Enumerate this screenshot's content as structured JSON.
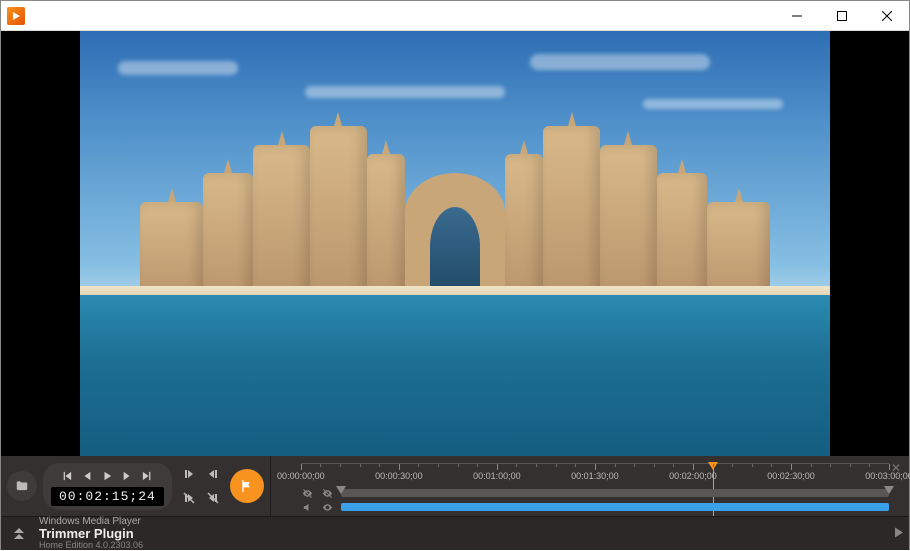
{
  "titlebar": {
    "app_name": ""
  },
  "transport": {
    "timecode": "00:02:15;24"
  },
  "timeline": {
    "ticks": [
      "00:00:00;00",
      "00:00:30;00",
      "00:01:00;00",
      "00:01:30;00",
      "00:02:00;00",
      "00:02:30;00",
      "00:03:00;00"
    ],
    "playhead_percent": 70,
    "tracks": [
      {
        "kind": "video",
        "muted": true,
        "color": "#5a5654"
      },
      {
        "kind": "audio",
        "muted": false,
        "color": "#3aa0e8"
      }
    ]
  },
  "info": {
    "line1": "Windows Media Player",
    "line2": "Trimmer Plugin",
    "line3": "Home Edition 4.0.2303.06"
  },
  "icons": {
    "folder": "folder-icon",
    "flag": "flag-icon"
  }
}
